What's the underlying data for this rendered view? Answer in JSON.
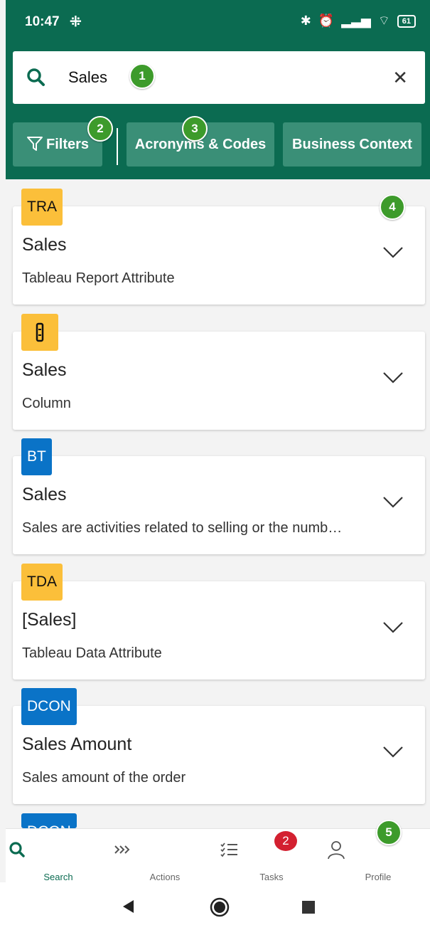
{
  "status_bar": {
    "time": "10:47",
    "battery": "61"
  },
  "search": {
    "query": "Sales"
  },
  "chips": [
    {
      "label": "Filters"
    },
    {
      "label": "Acronyms & Codes"
    },
    {
      "label": "Business Context"
    }
  ],
  "markers": [
    "1",
    "2",
    "3",
    "4",
    "5"
  ],
  "results": [
    {
      "badge": "TRA",
      "badge_color": "#fbbf3a",
      "title": "Sales",
      "subtitle": "Tableau Report Attribute"
    },
    {
      "badge": "",
      "badge_icon": "column-icon",
      "badge_color": "#fbbf3a",
      "title": "Sales",
      "subtitle": "Column"
    },
    {
      "badge": "BT",
      "badge_color": "#0a73c7",
      "title": "Sales",
      "subtitle": "Sales are activities related to selling or the numb…"
    },
    {
      "badge": "TDA",
      "badge_color": "#fbbf3a",
      "title": "[Sales]",
      "subtitle": "Tableau Data Attribute"
    },
    {
      "badge": "DCON",
      "badge_color": "#0a73c7",
      "title": "Sales Amount",
      "subtitle": "Sales amount of the order"
    },
    {
      "badge": "DCON",
      "badge_color": "#0a73c7"
    }
  ],
  "bottom_nav": [
    {
      "label": "Search",
      "icon": "search-icon"
    },
    {
      "label": "Actions",
      "icon": "actions-icon"
    },
    {
      "label": "Tasks",
      "icon": "tasks-icon",
      "badge": "2"
    },
    {
      "label": "Profile",
      "icon": "profile-icon"
    }
  ],
  "colors": {
    "header": "#0b6b51",
    "chip": "#3a8f77",
    "marker": "#3d9b2b",
    "task_badge": "#d32030"
  }
}
